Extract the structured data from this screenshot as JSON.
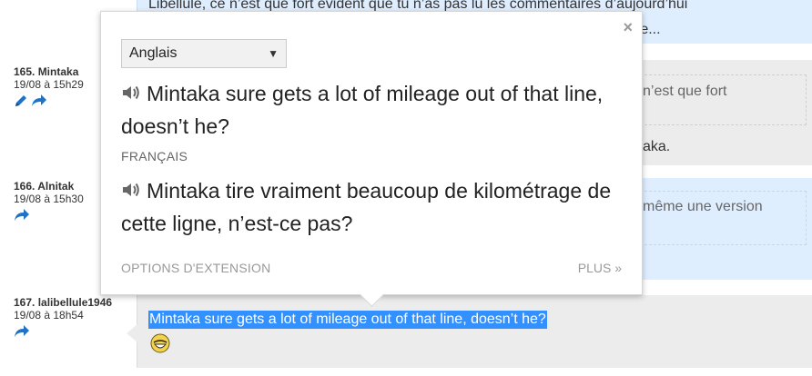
{
  "thread": {
    "top_comment": {
      "line1": "Libellule, ce n’est que fort évident que tu n’as pas lu les commentaires d’aujourd’hui",
      "line2": "...e..."
    },
    "comments": [
      {
        "author": "165. Mintaka",
        "date": "19/08 à 15h29",
        "quote_fragment": "n’est que fort",
        "text_fragment": "aka."
      },
      {
        "author": "166. Alnitak",
        "date": "19/08 à 15h30",
        "text_fragment": "même une version"
      },
      {
        "author": "167. lalibellule1946",
        "date": "19/08 à 18h54",
        "selected_text": "Mintaka sure gets a lot of mileage out of that line, doesn’t he?"
      }
    ]
  },
  "popup": {
    "close_label": "×",
    "source_language": "Anglais",
    "source_text": "Mintaka sure gets a lot of mileage out of that line, doesn’t he?",
    "target_language_label": "FRANÇAIS",
    "translated_text": "Mintaka tire vraiment beaucoup de kilométrage de cette ligne, n’est-ce pas?",
    "options_label": "OPTIONS D'EXTENSION",
    "more_label": "PLUS »"
  },
  "colors": {
    "accent_blue": "#1e73c8",
    "selection": "#3390ff",
    "bubble_blue": "#dfeeff",
    "bubble_grey": "#ececec"
  },
  "icons": [
    "edit-icon",
    "reply-icon",
    "speaker-icon",
    "smiley-icon",
    "close-icon",
    "dropdown-arrow-icon"
  ]
}
